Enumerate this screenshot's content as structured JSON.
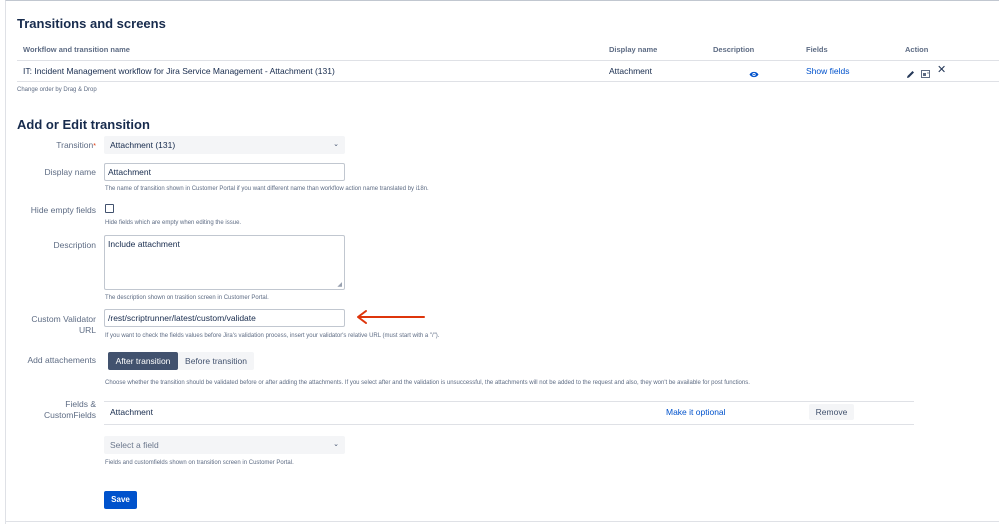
{
  "section1": {
    "title": "Transitions and screens",
    "columns": {
      "name": "Workflow and transition name",
      "display": "Display name",
      "description": "Description",
      "fields": "Fields",
      "action": "Action"
    },
    "row": {
      "name": "IT: Incident Management workflow for Jira Service Management - Attachment (131)",
      "display": "Attachment",
      "fields_link": "Show fields"
    },
    "note": "Change order by Drag & Drop"
  },
  "form": {
    "title": "Add or Edit transition",
    "transition_label": "Transition",
    "transition_required": "*",
    "transition_value": "Attachment (131)",
    "display_label": "Display name",
    "display_value": "Attachment",
    "display_help": "The name of transition shown in Customer Portal if you want different name than workflow action name translated by i18n.",
    "hide_label": "Hide empty fields",
    "hide_help": "Hide fields which are empty when editing the issue.",
    "desc_label": "Description",
    "desc_value": "Include attachment",
    "desc_help": "The description shown on trasition screen in Customer Portal.",
    "validator_label_1": "Custom Validator",
    "validator_label_2": "URL",
    "validator_value": "/rest/scriptrunner/latest/custom/validate",
    "validator_help": "If you want to check the fields values before Jira's validation process, insert your validator's relative URL (must start with a \"/\").",
    "attach_label": "Add attachements",
    "attach_options": [
      "After transition",
      "Before transition"
    ],
    "attach_help": "Choose whether the transition should be validated before or after adding the attachments. If you select after and the validation is unsuccessful, the attachments will not be added to the request and also, they won't be available for post functions.",
    "fields_label_1": "Fields &",
    "fields_label_2": "CustomFields",
    "field_row": {
      "name": "Attachment",
      "optional_link": "Make it optional",
      "remove": "Remove"
    },
    "select_placeholder": "Select a field",
    "fields_help": "Fields and customfields shown on transition screen in Customer Portal.",
    "save": "Save"
  },
  "colors": {
    "accent": "#0052cc",
    "arrow": "#de350b",
    "segment_active": "#42526e"
  }
}
